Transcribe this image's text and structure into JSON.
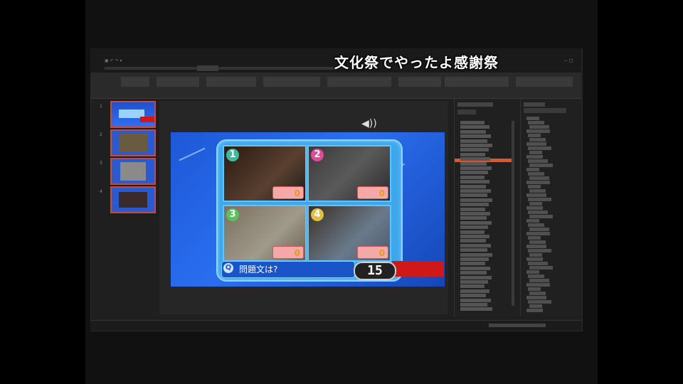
{
  "caption": "文化祭でやったよ感謝祭",
  "quiz": {
    "cells": [
      {
        "num": "1",
        "score": "0",
        "color": "#3fb9a0"
      },
      {
        "num": "2",
        "score": "0",
        "color": "#e04a9a"
      },
      {
        "num": "3",
        "score": "0",
        "color": "#5cc060"
      },
      {
        "num": "4",
        "score": "0",
        "color": "#e0c040"
      }
    ],
    "question": "問題文は?",
    "question_icon": "Q",
    "timer": "15"
  },
  "thumbnails": [
    {
      "num": "1"
    },
    {
      "num": "2"
    },
    {
      "num": "3"
    },
    {
      "num": "4"
    }
  ],
  "speaker_icon": "speaker-icon",
  "colors": {
    "slide_blue": "#1d58d8",
    "accent_red": "#d01818",
    "selection_orange": "#e0562a"
  }
}
